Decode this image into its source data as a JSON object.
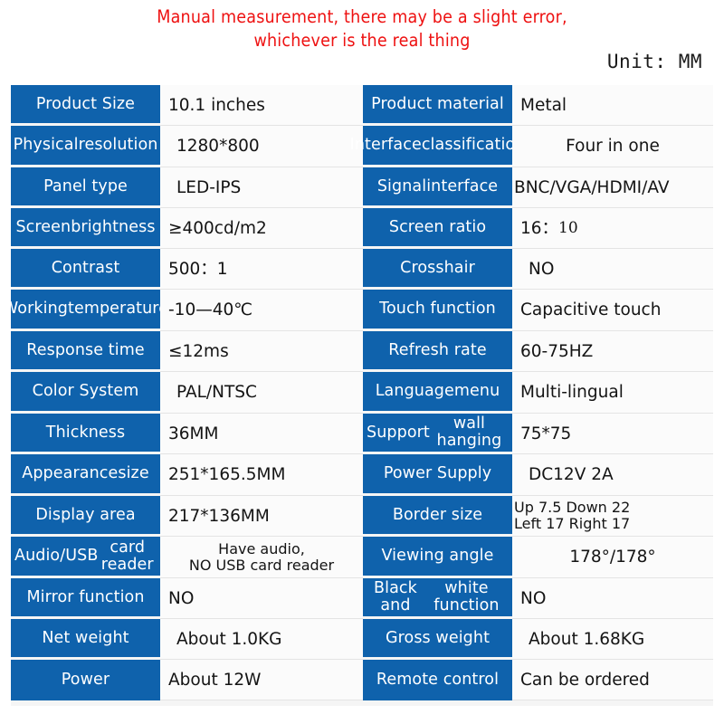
{
  "notice": {
    "line1": "Manual measurement, there may be a slight error,",
    "line2": "whichever is the real thing",
    "color": "#ee1111"
  },
  "unit_note": "Unit: MM",
  "theme": {
    "label_bg": "#0f62ac",
    "label_fg": "#ffffff",
    "value_bg": "#fbfbfb",
    "value_fg": "#141414",
    "table_bg": "#f5f5f5"
  },
  "spec_table": {
    "rows": [
      {
        "left": {
          "label": "Product Size",
          "value": "10.1 inches"
        },
        "right": {
          "label": "Product material",
          "value": "Metal"
        }
      },
      {
        "left": {
          "label": "Physical\nresolution",
          "value": "1280*800"
        },
        "right": {
          "label": "Interface\nclassification",
          "value": "Four in one"
        }
      },
      {
        "left": {
          "label": "Panel type",
          "value": "LED-IPS"
        },
        "right": {
          "label": "Signal\ninterface",
          "value": "BNC/VGA/HDMI/AV"
        }
      },
      {
        "left": {
          "label": "Screen\nbrightness",
          "value": "≥400cd/m2"
        },
        "right": {
          "label": "Screen ratio",
          "value": "16：",
          "value_suffix": "10"
        }
      },
      {
        "left": {
          "label": "Contrast",
          "value": "500：1"
        },
        "right": {
          "label": "Crosshair",
          "value": "NO"
        }
      },
      {
        "left": {
          "label": "Working\ntemperature",
          "value": "-10—40℃"
        },
        "right": {
          "label": "Touch function",
          "value": "Capacitive touch"
        }
      },
      {
        "left": {
          "label": "Response time",
          "value": "≤12ms"
        },
        "right": {
          "label": "Refresh rate",
          "value": "60-75HZ"
        }
      },
      {
        "left": {
          "label": "Color System",
          "value": "PAL/NTSC"
        },
        "right": {
          "label": "Language\nmenu",
          "value": "Multi-lingual"
        }
      },
      {
        "left": {
          "label": "Thickness",
          "value": "36MM"
        },
        "right": {
          "label": "Support\nwall hanging",
          "value": "75*75"
        }
      },
      {
        "left": {
          "label": "Appearance\nsize",
          "value": "251*165.5MM"
        },
        "right": {
          "label": "Power Supply",
          "value": "DC12V 2A"
        }
      },
      {
        "left": {
          "label": "Display area",
          "value": "217*136MM"
        },
        "right": {
          "label": "Border size",
          "value": "Up 7.5   Down 22\nLeft 17 Right 17"
        }
      },
      {
        "left": {
          "label": "Audio/USB\ncard reader",
          "value": "Have audio,\nNO USB card reader"
        },
        "right": {
          "label": "Viewing angle",
          "value": "178°/178°"
        }
      },
      {
        "left": {
          "label": "Mirror function",
          "value": "NO"
        },
        "right": {
          "label": "Black and\nwhite function",
          "value": "NO"
        }
      },
      {
        "left": {
          "label": "Net weight",
          "value": "About 1.0KG"
        },
        "right": {
          "label": "Gross weight",
          "value": "About 1.68KG"
        }
      },
      {
        "left": {
          "label": "Power",
          "value": "About 12W"
        },
        "right": {
          "label": "Remote control",
          "value": "Can be ordered"
        }
      }
    ]
  }
}
